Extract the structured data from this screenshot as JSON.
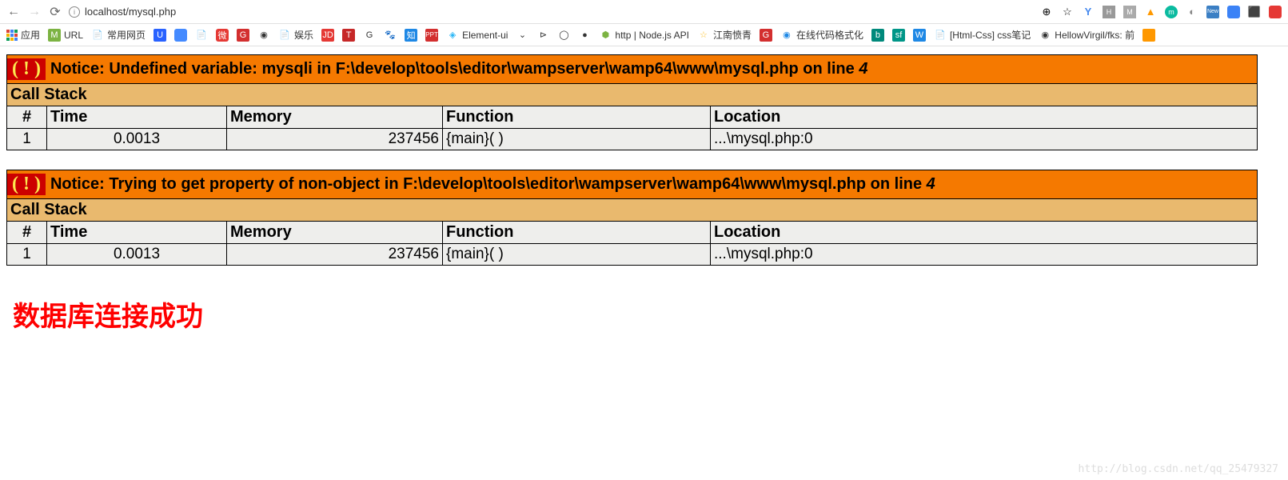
{
  "browser": {
    "url": "localhost/mysql.php",
    "zoom_icon": "⊕",
    "star": "☆"
  },
  "bookmarks": {
    "apps": "应用",
    "items": [
      "URL",
      "常用网页",
      "U",
      "",
      "",
      "",
      "G",
      "",
      "",
      "娱乐",
      "JD",
      "T",
      "G",
      "",
      "知",
      "",
      "",
      "Element-ui",
      "",
      "",
      "",
      "",
      "",
      "http | Node.js API",
      "",
      "江南愤青",
      "G",
      "",
      "在线代码格式化",
      "B",
      "sf",
      "W",
      "",
      "[Html-Css] css笔记",
      "",
      "HellowVirgil/fks: 前"
    ]
  },
  "errors": [
    {
      "badge": "( ! )",
      "message": "Notice: Undefined variable: mysqli in F:\\develop\\tools\\editor\\wampserver\\wamp64\\www\\mysql.php on line ",
      "line": "4",
      "call_stack_label": "Call Stack",
      "headers": [
        "#",
        "Time",
        "Memory",
        "Function",
        "Location"
      ],
      "rows": [
        {
          "num": "1",
          "time": "0.0013",
          "memory": "237456",
          "function": "{main}( )",
          "location": "...\\mysql.php:0"
        }
      ]
    },
    {
      "badge": "( ! )",
      "message": "Notice: Trying to get property of non-object in F:\\develop\\tools\\editor\\wampserver\\wamp64\\www\\mysql.php on line ",
      "line": "4",
      "call_stack_label": "Call Stack",
      "headers": [
        "#",
        "Time",
        "Memory",
        "Function",
        "Location"
      ],
      "rows": [
        {
          "num": "1",
          "time": "0.0013",
          "memory": "237456",
          "function": "{main}( )",
          "location": "...\\mysql.php:0"
        }
      ]
    }
  ],
  "success_message": "数据库连接成功",
  "watermark": "http://blog.csdn.net/qq_25479327"
}
